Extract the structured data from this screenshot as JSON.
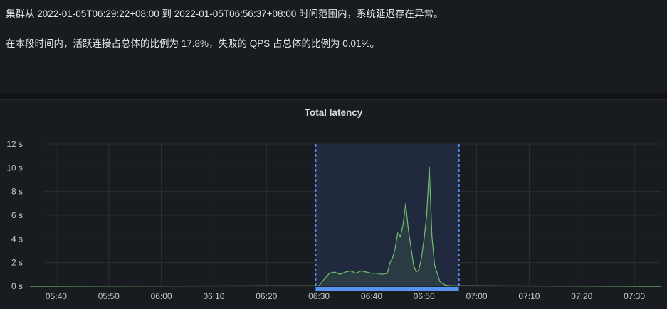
{
  "summary": {
    "line1": "集群从 2022-01-05T06:29:22+08:00 到 2022-01-05T06:56:37+08:00 时间范围内，系统延迟存在异常。",
    "line2": "在本段时间内，活跃连接占总体的比例为 17.8%，失败的 QPS 占总体的比例为 0.01%。"
  },
  "colors": {
    "background": "#111217",
    "panel": "#181b1f",
    "series": "#73bf69",
    "highlight_fill": "#222c44",
    "highlight_border": "#5794f2",
    "range_bar": "#5794f2"
  },
  "chart_data": {
    "type": "area",
    "title": "Total latency",
    "xlabel": "",
    "ylabel": "",
    "y_unit": "s",
    "ylim": [
      0,
      12
    ],
    "xlim": [
      "05:35",
      "07:35"
    ],
    "x_ticks": [
      "05:40",
      "05:50",
      "06:00",
      "06:10",
      "06:20",
      "06:30",
      "06:40",
      "06:50",
      "07:00",
      "07:10",
      "07:20",
      "07:30"
    ],
    "y_ticks": [
      "0 s",
      "2 s",
      "4 s",
      "6 s",
      "8 s",
      "10 s",
      "12 s"
    ],
    "grid": true,
    "highlight_range": [
      "06:29:22",
      "06:56:37"
    ],
    "series": [
      {
        "x": [
          "05:35",
          "06:30",
          "06:31",
          "06:32",
          "06:33",
          "06:34",
          "06:35",
          "06:36",
          "06:37",
          "06:38",
          "06:39",
          "06:40",
          "06:41",
          "06:42",
          "06:43",
          "06:43:30",
          "06:44",
          "06:44:30",
          "06:45",
          "06:45:30",
          "06:46",
          "06:46:30",
          "06:47",
          "06:48",
          "06:48:30",
          "06:49",
          "06:49:30",
          "06:50",
          "06:50:30",
          "06:51",
          "06:51:30",
          "06:52",
          "06:53",
          "06:54",
          "06:55",
          "06:56",
          "07:35"
        ],
        "values": [
          0,
          0.05,
          0.6,
          1.1,
          1.2,
          1.0,
          1.2,
          1.3,
          1.1,
          1.3,
          1.2,
          1.1,
          1.1,
          1.0,
          1.1,
          2.0,
          2.4,
          3.2,
          4.5,
          4.2,
          5.2,
          7.0,
          4.8,
          1.8,
          1.2,
          1.4,
          2.4,
          4.0,
          6.0,
          10.1,
          4.2,
          1.8,
          0.4,
          0.1,
          0.05,
          0.05,
          0
        ]
      }
    ]
  }
}
